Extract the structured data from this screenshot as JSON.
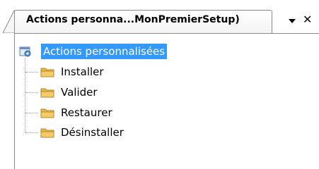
{
  "tab": {
    "title": "Actions personna...MonPremierSetup)",
    "dropdown_icon": "dropdown-arrow-icon",
    "close_label": "✕"
  },
  "tree": {
    "root": {
      "label": "Actions personnalisées",
      "icon": "custom-actions-icon",
      "selected": true
    },
    "children": [
      {
        "label": "Installer",
        "icon": "folder-icon"
      },
      {
        "label": "Valider",
        "icon": "folder-icon"
      },
      {
        "label": "Restaurer",
        "icon": "folder-icon"
      },
      {
        "label": "Désinstaller",
        "icon": "folder-icon"
      }
    ]
  },
  "colors": {
    "selection": "#3399ff",
    "folder": "#e8b84a"
  }
}
